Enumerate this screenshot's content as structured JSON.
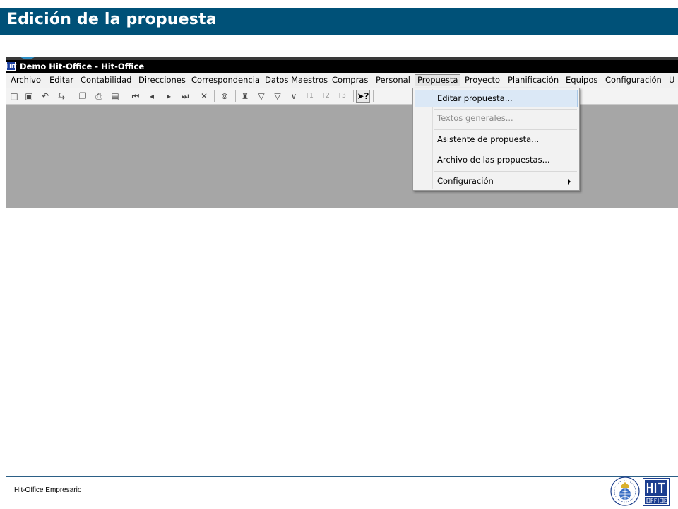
{
  "slide": {
    "title": "Edición de la propuesta",
    "footer": "Hit-Office Empresario"
  },
  "window": {
    "title": "Demo Hit-Office - Hit-Office",
    "app_icon_label": "HIT"
  },
  "menubar": {
    "items": [
      {
        "label": "Archivo"
      },
      {
        "label": "Editar"
      },
      {
        "label": "Contabilidad"
      },
      {
        "label": "Direcciones"
      },
      {
        "label": "Correspondencia"
      },
      {
        "label": "Datos Maestros"
      },
      {
        "label": "Compras"
      },
      {
        "label": "Personal"
      },
      {
        "label": "Propuesta"
      },
      {
        "label": "Proyecto"
      },
      {
        "label": "Planificación"
      },
      {
        "label": "Equipos"
      },
      {
        "label": "Configuración"
      },
      {
        "label": "U"
      }
    ],
    "active_index": 8
  },
  "toolbar": {
    "text_buttons": [
      "T1",
      "T2",
      "T3"
    ],
    "help_label": "?",
    "icons": [
      "new-icon",
      "save-icon",
      "undo-icon",
      "redo-icon",
      "copy-icon",
      "print-icon",
      "print-preview-icon",
      "first-record-icon",
      "prev-record-icon",
      "next-record-icon",
      "last-record-icon",
      "delete-icon",
      "link-icon",
      "find-icon",
      "filter-icon",
      "filter-add-icon",
      "filter-remove-icon",
      "help-pointer-icon"
    ]
  },
  "dropdown": {
    "items": [
      {
        "label": "Editar propuesta...",
        "state": "highlighted"
      },
      {
        "label": "Textos generales...",
        "state": "disabled"
      },
      {
        "label": "Asistente de propuesta...",
        "state": "normal"
      },
      {
        "label": "Archivo de las propuestas...",
        "state": "normal"
      },
      {
        "label": "Configuración",
        "state": "submenu"
      }
    ]
  },
  "colors": {
    "header_bg": "#005178",
    "footer_line": "#2b5f86",
    "workspace_bg": "#a6a6a6",
    "menu_highlight": "#dbe8f6"
  }
}
